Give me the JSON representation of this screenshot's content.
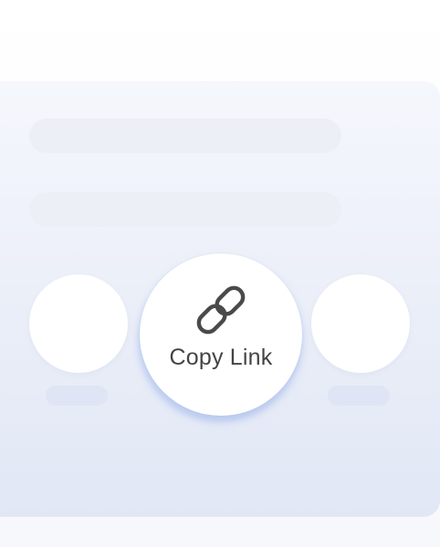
{
  "share_sheet": {
    "primary_action": {
      "label": "Copy Link",
      "icon": "link-icon"
    }
  },
  "colors": {
    "icon": "#4a4a4a",
    "text": "#444444",
    "accent_glow": "#c9d7f7"
  }
}
